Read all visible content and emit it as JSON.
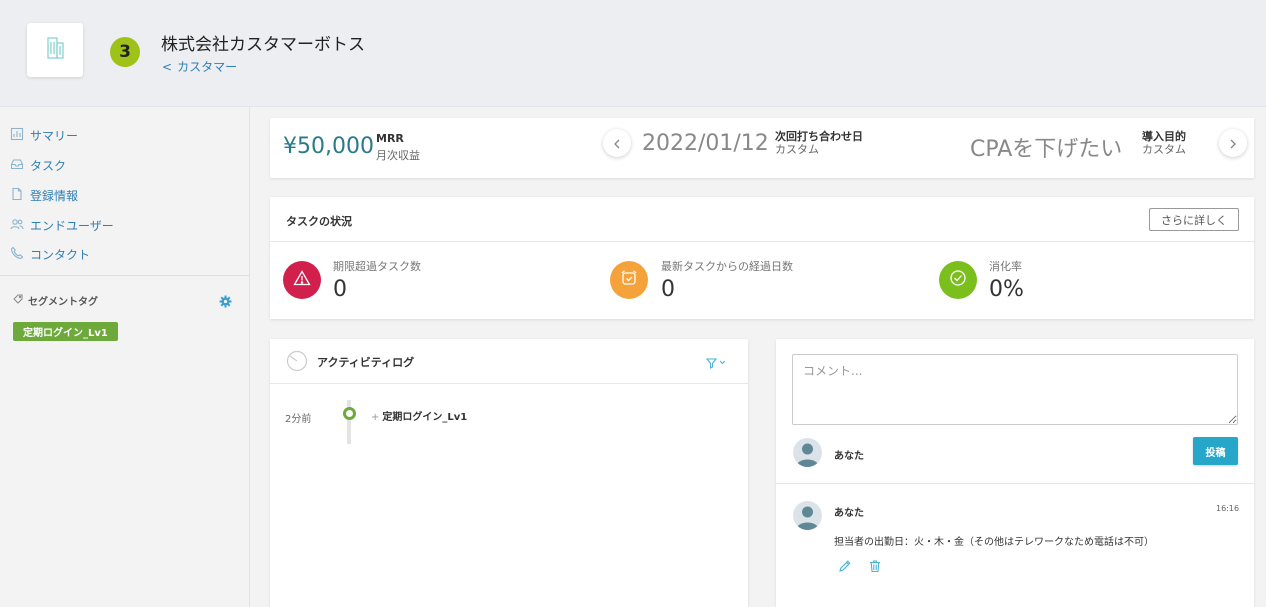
{
  "colors": {
    "accent": "#2f7fb4",
    "badge": "#9ec217",
    "tag": "#6da93b",
    "overdue": "#d2204d",
    "elapsed": "#f5a23a",
    "rate": "#7bbf1c",
    "post_button": "#26a6c9"
  },
  "header": {
    "logo_icon": "building-icon",
    "badge_number": "3",
    "company_name": "株式会社カスタマーボトス",
    "back_link": "カスタマー"
  },
  "sidebar": {
    "items": [
      {
        "label": "サマリー",
        "icon": "summary-icon"
      },
      {
        "label": "タスク",
        "icon": "inbox-icon"
      },
      {
        "label": "登録情報",
        "icon": "document-icon"
      },
      {
        "label": "エンドユーザー",
        "icon": "users-icon"
      },
      {
        "label": "コンタクト",
        "icon": "phone-icon"
      }
    ],
    "segment_title": "セグメントタグ",
    "segment_tag": "定期ログイン_Lv1"
  },
  "kpi": {
    "mrr_value": "¥50,000",
    "mrr_label": "MRR",
    "mrr_sub": "月次収益",
    "date_value": "2022/01/12",
    "date_label": "次回打ち合わせ日",
    "date_sub": "カスタム",
    "goal_value": "CPAを下げたい",
    "goal_label": "導入目的",
    "goal_sub": "カスタム"
  },
  "task_status": {
    "title": "タスクの状況",
    "more_button": "さらに詳しく",
    "stats": [
      {
        "label": "期限超過タスク数",
        "value": "0",
        "icon": "warning-icon"
      },
      {
        "label": "最新タスクからの経過日数",
        "value": "0",
        "icon": "alarm-clock-icon"
      },
      {
        "label": "消化率",
        "value": "0%",
        "icon": "check-circle-icon"
      }
    ]
  },
  "activity": {
    "title": "アクティビティログ",
    "entries": [
      {
        "time": "2分前",
        "text": "定期ログイン_Lv1"
      }
    ]
  },
  "comments": {
    "placeholder": "コメント...",
    "current_user": "あなた",
    "post_button": "投稿",
    "items": [
      {
        "author": "あなた",
        "time": "16:16",
        "body": "担当者の出勤日：火・木・金（その他はテレワークなため電話は不可）"
      }
    ]
  }
}
